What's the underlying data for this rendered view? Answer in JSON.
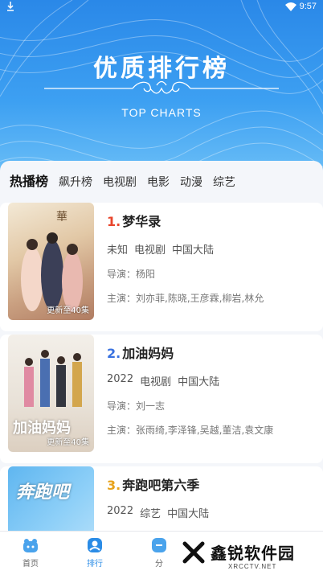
{
  "status": {
    "time": "9:57"
  },
  "hero": {
    "title": "优质排行榜",
    "subtitle": "TOP CHARTS"
  },
  "tabs": [
    {
      "label": "热播榜",
      "active": true
    },
    {
      "label": "飙升榜",
      "active": false
    },
    {
      "label": "电视剧",
      "active": false
    },
    {
      "label": "电影",
      "active": false
    },
    {
      "label": "动漫",
      "active": false
    },
    {
      "label": "综艺",
      "active": false
    }
  ],
  "items": [
    {
      "rank": "1.",
      "rank_color": "#e8452c",
      "title": "梦华录",
      "year": "未知",
      "genre": "电视剧",
      "region": "中国大陆",
      "director": "导演：杨阳",
      "cast": "主演：刘亦菲,陈晓,王彦霖,柳岩,林允",
      "badge": "更新至40集"
    },
    {
      "rank": "2.",
      "rank_color": "#3a72e0",
      "title": "加油妈妈",
      "year": "2022",
      "genre": "电视剧",
      "region": "中国大陆",
      "director": "导演：刘一志",
      "cast": "主演：张雨绮,李泽锋,吴越,董洁,袁文康",
      "badge": "更新至40集",
      "poster_text": "加油妈妈"
    },
    {
      "rank": "3.",
      "rank_color": "#e7a21a",
      "title": "奔跑吧第六季",
      "year": "2022",
      "genre": "综艺",
      "region": "中国大陆",
      "poster_text": "奔跑吧"
    }
  ],
  "nav": [
    {
      "label": "首页",
      "icon": "home-icon",
      "active": false
    },
    {
      "label": "排行",
      "icon": "rank-icon",
      "active": true
    },
    {
      "label": "分",
      "icon": "category-icon",
      "active": false
    }
  ],
  "watermark": {
    "text": "鑫锐软件园",
    "sub": "XRCCTV.NET"
  },
  "colors": {
    "accent": "#2b8ce6",
    "hero_top": "#2a88e8"
  }
}
